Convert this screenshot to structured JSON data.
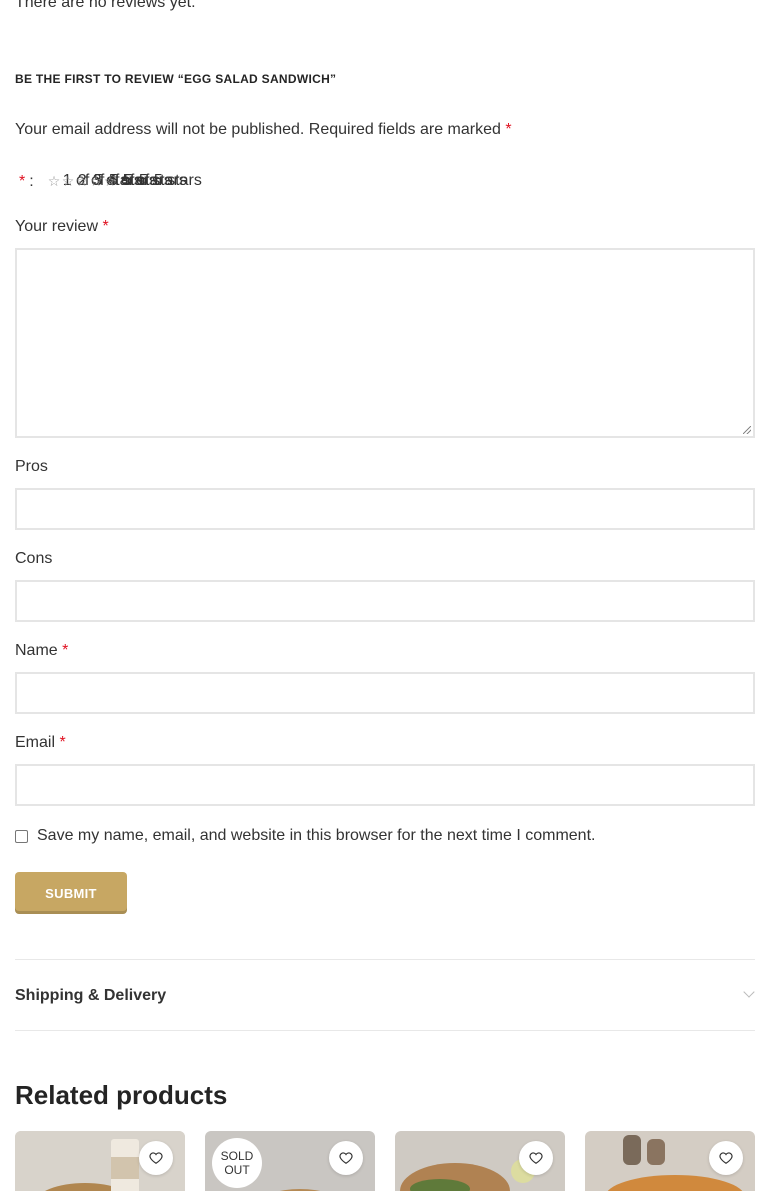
{
  "reviews": {
    "empty_text": "There are no reviews yet.",
    "reply_title": "Be the first to review “Egg Salad Sandwich”",
    "notes": "Your email address will not be published. Required fields are marked",
    "required_mark": "*",
    "rating": {
      "colon": ":",
      "overlapping_labels": [
        "1 of 5 stars",
        "2 of 5 stars",
        "3 of 5 stars",
        "4 of 5 stars",
        "5 of 5 stars"
      ],
      "star_count": 5
    },
    "fields": {
      "review_label": "Your review",
      "pros_label": "Pros",
      "cons_label": "Cons",
      "name_label": "Name",
      "email_label": "Email"
    },
    "consent_label": "Save my name, email, and website in this browser for the next time I comment.",
    "submit_label": "Submit"
  },
  "accordion": {
    "title": "Shipping & Delivery"
  },
  "related": {
    "title": "Related products",
    "products": [
      {
        "badge": ""
      },
      {
        "badge_line1": "Sold",
        "badge_line2": "out"
      },
      {
        "badge": ""
      },
      {
        "badge": ""
      }
    ]
  },
  "colors": {
    "accent": "#c7a763",
    "required": "#e01020"
  }
}
